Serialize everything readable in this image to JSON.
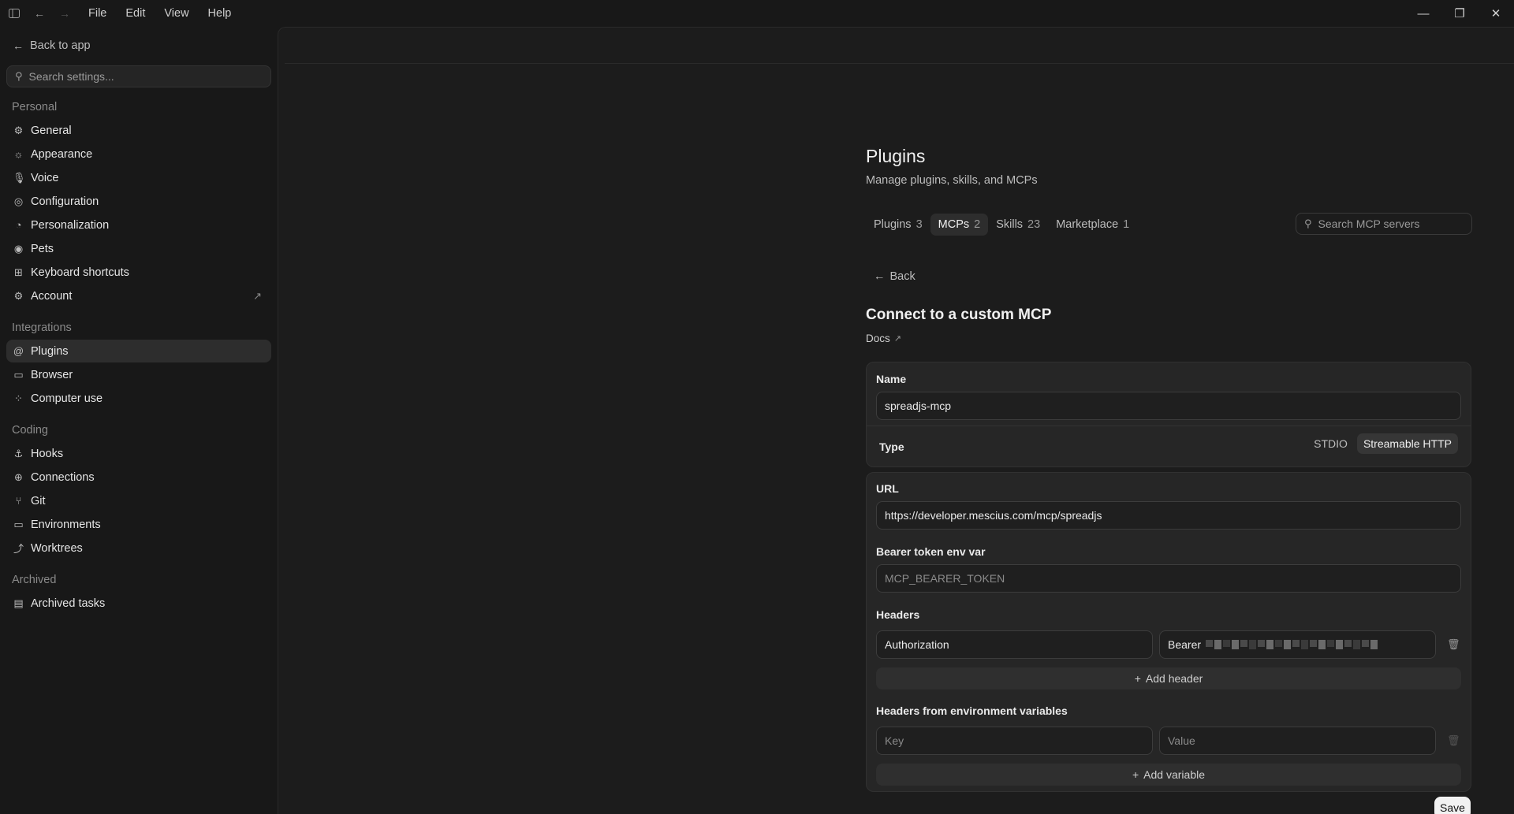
{
  "menu": [
    "File",
    "Edit",
    "View",
    "Help"
  ],
  "sidebar": {
    "back_label": "Back to app",
    "search_placeholder": "Search settings...",
    "sections": {
      "personal": "Personal",
      "integrations": "Integrations",
      "coding": "Coding",
      "archived": "Archived"
    },
    "personal_items": [
      "General",
      "Appearance",
      "Voice",
      "Configuration",
      "Personalization",
      "Pets",
      "Keyboard shortcuts",
      "Account"
    ],
    "integration_items": [
      "Plugins",
      "Browser",
      "Computer use"
    ],
    "coding_items": [
      "Hooks",
      "Connections",
      "Git",
      "Environments",
      "Worktrees"
    ],
    "archived_items": [
      "Archived tasks"
    ]
  },
  "page": {
    "title": "Plugins",
    "subtitle": "Manage plugins, skills, and MCPs",
    "tabs": [
      {
        "label": "Plugins",
        "count": "3"
      },
      {
        "label": "MCPs",
        "count": "2"
      },
      {
        "label": "Skills",
        "count": "23"
      },
      {
        "label": "Marketplace",
        "count": "1"
      }
    ],
    "search_placeholder": "Search MCP servers"
  },
  "form": {
    "back_label": "Back",
    "title": "Connect to a custom MCP",
    "docs_label": "Docs",
    "name_label": "Name",
    "name_value": "spreadjs-mcp",
    "type_label": "Type",
    "type_options": [
      "STDIO",
      "Streamable HTTP"
    ],
    "url_label": "URL",
    "url_value": "https://developer.mescius.com/mcp/spreadjs",
    "bearer_label": "Bearer token env var",
    "bearer_placeholder": "MCP_BEARER_TOKEN",
    "headers_label": "Headers",
    "header_key": "Authorization",
    "header_value_prefix": "Bearer",
    "add_header_label": "Add header",
    "env_headers_label": "Headers from environment variables",
    "env_key_placeholder": "Key",
    "env_value_placeholder": "Value",
    "add_variable_label": "Add variable",
    "save_label": "Save"
  },
  "icons": {
    "sidebar_toggle": "sidebar-toggle-icon",
    "back": "arrow-left-icon",
    "forward": "arrow-right-icon",
    "search": "search-icon",
    "external": "external-link-icon",
    "trash": "trash-icon",
    "plus": "plus-icon"
  }
}
